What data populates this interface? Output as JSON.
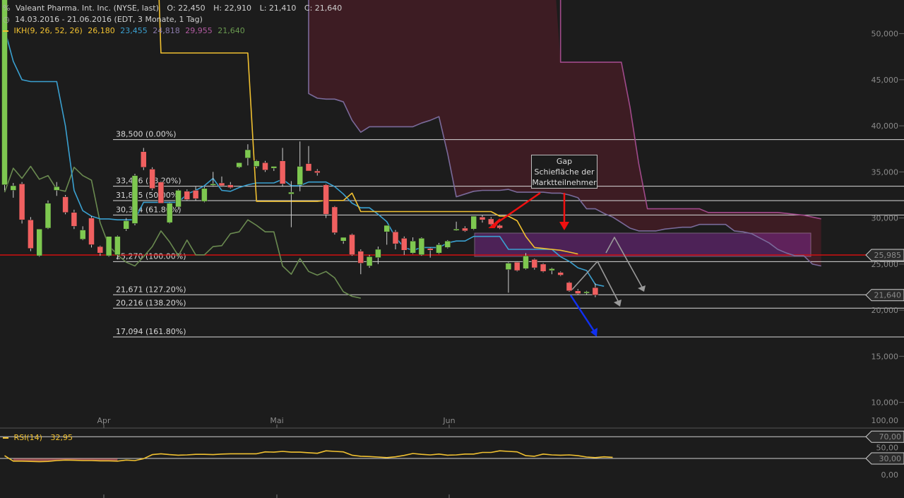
{
  "header": {
    "instrument": "Valeant Pharma. Int. Inc. (NYSE, last)",
    "open": "O: 22,450",
    "high": "H: 22,910",
    "low": "L: 21,410",
    "close": "C: 21,640",
    "period": "14.03.2016 - 21.06.2016 (EDT, 3 Monate, 1 Tag)",
    "ikh_label": "IKH(9, 26, 52, 26)",
    "ikh_values": [
      "26,180",
      "23,455",
      "24,818",
      "29,955",
      "21,640"
    ]
  },
  "colors": {
    "background": "#1c1c1c",
    "up": "#7ec850",
    "down": "#f06060",
    "tenkan": "#3aa0d0",
    "kijun": "#f0c030",
    "senkou_a": "#7a6a9a",
    "senkou_b": "#a04a8a",
    "chikou": "#6a8a50",
    "support": "#d01010",
    "rsi": "#f0c030"
  },
  "annotation": {
    "gap_lines": [
      "Gap",
      "Schiefläche der",
      "Marktteilnehmer"
    ]
  },
  "chart_data": {
    "type": "candlestick",
    "y_range": [
      5,
      52
    ],
    "y_ticks": [
      "50,000",
      "45,000",
      "40,000",
      "35,000",
      "30,000",
      "25,000",
      "20,000",
      "15,000",
      "10,000"
    ],
    "x_labels": [
      "Apr",
      "Mai",
      "Jun"
    ],
    "last_price": "21,640",
    "support_level": "25,985",
    "fibonacci": [
      {
        "label": "38,500 (0.00%)",
        "value": 38.5
      },
      {
        "label": "33,446 (38.20%)",
        "value": 33.446
      },
      {
        "label": "31,885 (50.00%)",
        "value": 31.885
      },
      {
        "label": "30,324 (61.80%)",
        "value": 30.324
      },
      {
        "label": "25,270 (100.00%)",
        "value": 25.27
      },
      {
        "label": "21,671 (127.20%)",
        "value": 21.671
      },
      {
        "label": "20,216 (138.20%)",
        "value": 20.216
      },
      {
        "label": "17,094 (161.80%)",
        "value": 17.094
      }
    ],
    "candles": [
      {
        "o": 33.6,
        "h": 56,
        "l": 33.0,
        "c": 55
      },
      {
        "o": 33.0,
        "h": 33.8,
        "l": 32.2,
        "c": 33.5
      },
      {
        "o": 33.7,
        "h": 33.9,
        "l": 29.4,
        "c": 29.8
      },
      {
        "o": 29.8,
        "h": 30.1,
        "l": 26.4,
        "c": 26.7
      },
      {
        "o": 25.9,
        "h": 28.8,
        "l": 25.8,
        "c": 28.8
      },
      {
        "o": 28.9,
        "h": 31.9,
        "l": 28.8,
        "c": 31.6
      },
      {
        "o": 33.0,
        "h": 33.9,
        "l": 32.4,
        "c": 33.4
      },
      {
        "o": 32.3,
        "h": 32.5,
        "l": 30.4,
        "c": 30.6
      },
      {
        "o": 30.6,
        "h": 30.9,
        "l": 28.8,
        "c": 29.1
      },
      {
        "o": 27.7,
        "h": 29.1,
        "l": 27.6,
        "c": 28.7
      },
      {
        "o": 30.0,
        "h": 30.2,
        "l": 26.8,
        "c": 27.1
      },
      {
        "o": 26.9,
        "h": 27.0,
        "l": 25.9,
        "c": 26.2
      },
      {
        "o": 25.9,
        "h": 27.9,
        "l": 25.8,
        "c": 28.0
      },
      {
        "o": 26.0,
        "h": 28.1,
        "l": 25.5,
        "c": 28.0
      },
      {
        "o": 28.8,
        "h": 30.0,
        "l": 28.6,
        "c": 29.7
      },
      {
        "o": 29.4,
        "h": 34.8,
        "l": 29.2,
        "c": 34.6
      },
      {
        "o": 37.2,
        "h": 37.6,
        "l": 35.2,
        "c": 35.5
      },
      {
        "o": 35.3,
        "h": 35.5,
        "l": 33.0,
        "c": 33.2
      },
      {
        "o": 33.9,
        "h": 34.0,
        "l": 31.6,
        "c": 31.6
      },
      {
        "o": 29.5,
        "h": 31.7,
        "l": 29.4,
        "c": 31.6
      },
      {
        "o": 31.2,
        "h": 33.1,
        "l": 30.9,
        "c": 33.0
      },
      {
        "o": 32.9,
        "h": 33.1,
        "l": 31.9,
        "c": 32.0
      },
      {
        "o": 33.0,
        "h": 33.4,
        "l": 31.9,
        "c": 32.1
      },
      {
        "o": 31.8,
        "h": 33.4,
        "l": 31.7,
        "c": 33.2
      },
      {
        "o": 33.6,
        "h": 35.0,
        "l": 33.4,
        "c": 33.7
      },
      {
        "o": 33.8,
        "h": 34.5,
        "l": 33.4,
        "c": 33.5
      },
      {
        "o": 33.6,
        "h": 33.9,
        "l": 33.2,
        "c": 33.3
      },
      {
        "o": 35.5,
        "h": 36.0,
        "l": 35.4,
        "c": 36.0
      },
      {
        "o": 36.5,
        "h": 38.0,
        "l": 35.7,
        "c": 37.4
      },
      {
        "o": 35.6,
        "h": 36.3,
        "l": 35.4,
        "c": 36.2
      },
      {
        "o": 36.0,
        "h": 36.2,
        "l": 35.0,
        "c": 35.2
      },
      {
        "o": 35.4,
        "h": 35.6,
        "l": 35.1,
        "c": 35.6
      },
      {
        "o": 36.2,
        "h": 37.6,
        "l": 33.4,
        "c": 33.7
      },
      {
        "o": 32.6,
        "h": 34.0,
        "l": 29.0,
        "c": 32.8
      },
      {
        "o": 33.6,
        "h": 38.3,
        "l": 32.9,
        "c": 35.6
      },
      {
        "o": 35.9,
        "h": 37.8,
        "l": 35.1,
        "c": 35.1
      },
      {
        "o": 35.1,
        "h": 35.3,
        "l": 34.6,
        "c": 34.9
      },
      {
        "o": 33.6,
        "h": 33.7,
        "l": 30.0,
        "c": 30.4
      },
      {
        "o": 31.2,
        "h": 31.3,
        "l": 28.2,
        "c": 28.4
      },
      {
        "o": 27.5,
        "h": 27.9,
        "l": 27.2,
        "c": 27.9
      },
      {
        "o": 28.2,
        "h": 28.3,
        "l": 25.9,
        "c": 26.0
      },
      {
        "o": 26.4,
        "h": 26.6,
        "l": 23.9,
        "c": 25.1
      },
      {
        "o": 24.8,
        "h": 26.0,
        "l": 24.6,
        "c": 25.8
      },
      {
        "o": 25.7,
        "h": 26.9,
        "l": 25.0,
        "c": 26.6
      },
      {
        "o": 28.5,
        "h": 29.1,
        "l": 27.1,
        "c": 29.2
      },
      {
        "o": 28.5,
        "h": 28.7,
        "l": 26.6,
        "c": 27.2
      },
      {
        "o": 27.8,
        "h": 28.0,
        "l": 26.0,
        "c": 26.5
      },
      {
        "o": 26.2,
        "h": 27.9,
        "l": 26.1,
        "c": 27.5
      },
      {
        "o": 26.0,
        "h": 27.9,
        "l": 25.9,
        "c": 27.8
      },
      {
        "o": 26.7,
        "h": 26.8,
        "l": 25.7,
        "c": 26.5
      },
      {
        "o": 26.2,
        "h": 27.3,
        "l": 26.1,
        "c": 27.1
      },
      {
        "o": 26.8,
        "h": 27.6,
        "l": 26.7,
        "c": 27.5
      },
      {
        "o": 28.7,
        "h": 29.6,
        "l": 28.6,
        "c": 28.8
      },
      {
        "o": 28.9,
        "h": 29.1,
        "l": 28.5,
        "c": 28.6
      },
      {
        "o": 28.8,
        "h": 30.2,
        "l": 28.7,
        "c": 30.2
      },
      {
        "o": 30.1,
        "h": 30.3,
        "l": 29.5,
        "c": 29.8
      },
      {
        "o": 29.9,
        "h": 30.1,
        "l": 29.2,
        "c": 29.3
      },
      {
        "o": 29.2,
        "h": 29.3,
        "l": 28.8,
        "c": 28.9
      },
      {
        "o": 24.4,
        "h": 25.2,
        "l": 21.9,
        "c": 25.1
      },
      {
        "o": 25.2,
        "h": 25.3,
        "l": 24.2,
        "c": 24.3
      },
      {
        "o": 24.5,
        "h": 26.2,
        "l": 24.4,
        "c": 25.9
      },
      {
        "o": 25.5,
        "h": 25.6,
        "l": 24.4,
        "c": 24.6
      },
      {
        "o": 25.0,
        "h": 25.1,
        "l": 24.1,
        "c": 24.2
      },
      {
        "o": 24.3,
        "h": 24.6,
        "l": 23.9,
        "c": 24.5
      },
      {
        "o": 24.1,
        "h": 24.2,
        "l": 23.7,
        "c": 23.8
      },
      {
        "o": 23.0,
        "h": 23.1,
        "l": 22.0,
        "c": 22.1
      },
      {
        "o": 22.1,
        "h": 22.3,
        "l": 21.7,
        "c": 21.8
      },
      {
        "o": 21.9,
        "h": 22.1,
        "l": 21.7,
        "c": 22.0
      },
      {
        "o": 22.45,
        "h": 22.91,
        "l": 21.41,
        "c": 21.64
      }
    ],
    "tenkan": [
      50.5,
      47.0,
      45.0,
      44.8,
      44.8,
      44.8,
      44.8,
      40.0,
      33.0,
      30.8,
      30.2,
      29.9,
      29.9,
      29.8,
      29.8,
      29.8,
      31.7,
      31.7,
      31.7,
      31.7,
      31.7,
      32.6,
      33.0,
      33.5,
      34.3,
      33.0,
      32.9,
      33.3,
      33.6,
      33.8,
      33.8,
      33.8,
      34.2,
      33.5,
      33.5,
      33.9,
      33.9,
      33.9,
      33.4,
      32.6,
      31.6,
      31.1,
      31.1,
      30.4,
      29.6,
      27.9,
      26.8,
      26.5,
      26.8,
      26.8,
      26.8,
      27.3,
      27.5,
      27.5,
      28.0,
      28.0,
      28.0,
      28.0,
      26.6,
      26.6,
      26.6,
      26.6,
      26.6,
      26.6,
      25.8,
      25.3,
      24.6,
      24.3,
      22.8,
      22.6
    ],
    "kijun": [
      75,
      75,
      75,
      75,
      75,
      75,
      75,
      75,
      75,
      75,
      75,
      75,
      75,
      75,
      75,
      75,
      75,
      75,
      47.9,
      47.9,
      47.9,
      47.9,
      47.9,
      47.9,
      47.9,
      47.9,
      47.9,
      47.9,
      47.9,
      31.8,
      31.8,
      31.8,
      31.8,
      31.8,
      31.8,
      31.8,
      31.8,
      31.9,
      31.9,
      31.9,
      32.7,
      30.7,
      30.7,
      30.7,
      30.7,
      30.7,
      30.7,
      30.7,
      30.7,
      30.7,
      30.7,
      30.7,
      30.7,
      30.7,
      30.7,
      30.7,
      30.7,
      30.2,
      30.2,
      29.7,
      28.0,
      26.8,
      26.7,
      26.6,
      26.5,
      26.3,
      26.1
    ],
    "senkou_a": [
      [
        35,
        75
      ],
      [
        35,
        75
      ],
      [
        35,
        43.5
      ],
      [
        36,
        43.0
      ],
      [
        37,
        42.9
      ],
      [
        38,
        42.9
      ],
      [
        39,
        42.6
      ],
      [
        40,
        40.6
      ],
      [
        41,
        39.3
      ],
      [
        42,
        39.9
      ],
      [
        43,
        39.9
      ],
      [
        44,
        39.9
      ],
      [
        45,
        39.9
      ],
      [
        46,
        39.9
      ],
      [
        47,
        39.9
      ],
      [
        48,
        40.3
      ],
      [
        49,
        40.6
      ],
      [
        50,
        41.0
      ],
      [
        51,
        37.0
      ],
      [
        52,
        32.3
      ],
      [
        53,
        32.6
      ],
      [
        54,
        32.9
      ],
      [
        55,
        33.0
      ],
      [
        56,
        33.0
      ],
      [
        57,
        33.0
      ],
      [
        58,
        33.1
      ],
      [
        59,
        32.8
      ],
      [
        60,
        32.8
      ],
      [
        61,
        32.8
      ],
      [
        62,
        32.8
      ],
      [
        63,
        32.7
      ],
      [
        64,
        32.7
      ],
      [
        65,
        32.5
      ],
      [
        66,
        32.2
      ],
      [
        67,
        31.0
      ],
      [
        68,
        31.0
      ],
      [
        69,
        30.5
      ],
      [
        70,
        30.1
      ],
      [
        71,
        29.5
      ],
      [
        72,
        28.9
      ],
      [
        73,
        28.6
      ],
      [
        74,
        28.6
      ],
      [
        75,
        28.6
      ],
      [
        76,
        28.8
      ],
      [
        77,
        28.9
      ],
      [
        78,
        29.0
      ],
      [
        79,
        29.0
      ],
      [
        80,
        29.3
      ],
      [
        81,
        29.3
      ],
      [
        82,
        29.3
      ],
      [
        83,
        29.3
      ],
      [
        84,
        28.6
      ],
      [
        85,
        28.5
      ],
      [
        86,
        28.3
      ],
      [
        87,
        27.8
      ],
      [
        88,
        27.3
      ],
      [
        89,
        26.6
      ],
      [
        90,
        26.2
      ],
      [
        91,
        25.9
      ],
      [
        92,
        25.9
      ],
      [
        93,
        25.0
      ],
      [
        94,
        24.8
      ]
    ],
    "senkou_b": [
      [
        63,
        60
      ],
      [
        64,
        60
      ],
      [
        64,
        46.9
      ],
      [
        65,
        46.9
      ],
      [
        66,
        46.9
      ],
      [
        67,
        46.9
      ],
      [
        68,
        46.9
      ],
      [
        69,
        46.9
      ],
      [
        70,
        46.9
      ],
      [
        71,
        46.9
      ],
      [
        72,
        42.0
      ],
      [
        73,
        35.9
      ],
      [
        74,
        31.0
      ],
      [
        75,
        31.0
      ],
      [
        76,
        31.0
      ],
      [
        77,
        31.0
      ],
      [
        78,
        31.0
      ],
      [
        79,
        31.0
      ],
      [
        80,
        31.0
      ],
      [
        81,
        30.6
      ],
      [
        82,
        30.6
      ],
      [
        83,
        30.6
      ],
      [
        84,
        30.6
      ],
      [
        85,
        30.6
      ],
      [
        86,
        30.6
      ],
      [
        87,
        30.6
      ],
      [
        88,
        30.6
      ],
      [
        89,
        30.6
      ],
      [
        90,
        30.5
      ],
      [
        91,
        30.4
      ],
      [
        92,
        30.3
      ],
      [
        93,
        30.1
      ],
      [
        94,
        29.9
      ]
    ],
    "chikou": [
      [
        0,
        32.8
      ],
      [
        1,
        35.4
      ],
      [
        2,
        34.3
      ],
      [
        3,
        35.6
      ],
      [
        4,
        34.2
      ],
      [
        5,
        34.6
      ],
      [
        6,
        33.1
      ],
      [
        7,
        32.9
      ],
      [
        8,
        35.5
      ],
      [
        9,
        34.6
      ],
      [
        10,
        34.1
      ],
      [
        11,
        29.5
      ],
      [
        12,
        27.0
      ],
      [
        13,
        26.0
      ],
      [
        14,
        25.2
      ],
      [
        15,
        24.8
      ],
      [
        16,
        25.8
      ],
      [
        17,
        26.9
      ],
      [
        18,
        28.6
      ],
      [
        19,
        27.4
      ],
      [
        20,
        25.9
      ],
      [
        21,
        27.6
      ],
      [
        22,
        26.0
      ],
      [
        23,
        26.0
      ],
      [
        24,
        26.9
      ],
      [
        25,
        27.0
      ],
      [
        26,
        28.3
      ],
      [
        27,
        28.5
      ],
      [
        28,
        29.8
      ],
      [
        29,
        29.2
      ],
      [
        30,
        28.5
      ],
      [
        31,
        28.5
      ],
      [
        32,
        24.8
      ],
      [
        33,
        23.9
      ],
      [
        34,
        25.6
      ],
      [
        35,
        24.2
      ],
      [
        36,
        23.8
      ],
      [
        37,
        24.2
      ],
      [
        38,
        23.5
      ],
      [
        39,
        22.0
      ],
      [
        40,
        21.5
      ],
      [
        41,
        21.3
      ]
    ],
    "rsi": {
      "label": "RSI(14)",
      "value": "32,95",
      "y_ticks": [
        "100,00",
        "50,00",
        "0,00"
      ],
      "levels": [
        "70,00",
        "30,00"
      ],
      "values": [
        35,
        25,
        25,
        24.5,
        24,
        24.5,
        26,
        27,
        26.5,
        26,
        26,
        25.5,
        25.5,
        25,
        27,
        26,
        29.5,
        37,
        38.5,
        37,
        36,
        36.5,
        37.5,
        37.5,
        37,
        38,
        38.5,
        38.5,
        38.5,
        38.5,
        42,
        41.5,
        43,
        41.5,
        41.5,
        40.5,
        39.5,
        44,
        43,
        42,
        36,
        34,
        33.5,
        32.5,
        31.5,
        33,
        35.5,
        39,
        37.5,
        36.5,
        38,
        36,
        36.5,
        38,
        38,
        41,
        41,
        44,
        43,
        42,
        35,
        34,
        38,
        36.5,
        36,
        36.5,
        35,
        32.5,
        31.5,
        33,
        32
      ]
    }
  }
}
